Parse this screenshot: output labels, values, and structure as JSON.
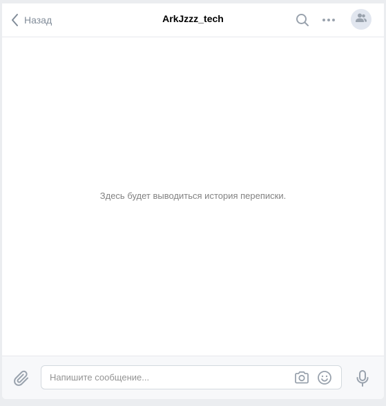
{
  "header": {
    "back_label": "Назад",
    "title": "ArkJzzz_tech",
    "icons": {
      "back": "chevron-left-icon",
      "search": "search-icon",
      "more": "more-horizontal-icon",
      "avatar": "users-icon"
    }
  },
  "history": {
    "placeholder": "Здесь будет выводиться история переписки."
  },
  "composer": {
    "placeholder": "Напишите сообщение...",
    "value": "",
    "icons": {
      "attach": "paperclip-icon",
      "camera": "camera-icon",
      "emoji": "smile-icon",
      "mic": "microphone-icon"
    }
  },
  "colors": {
    "accent_icon": "#99a2ad",
    "back_icon": "#818c99",
    "avatar_bg": "#e1e6ef",
    "avatar_icon": "#99a2ad",
    "border": "#e7e8ec",
    "composer_bg": "#f7f8fa"
  }
}
